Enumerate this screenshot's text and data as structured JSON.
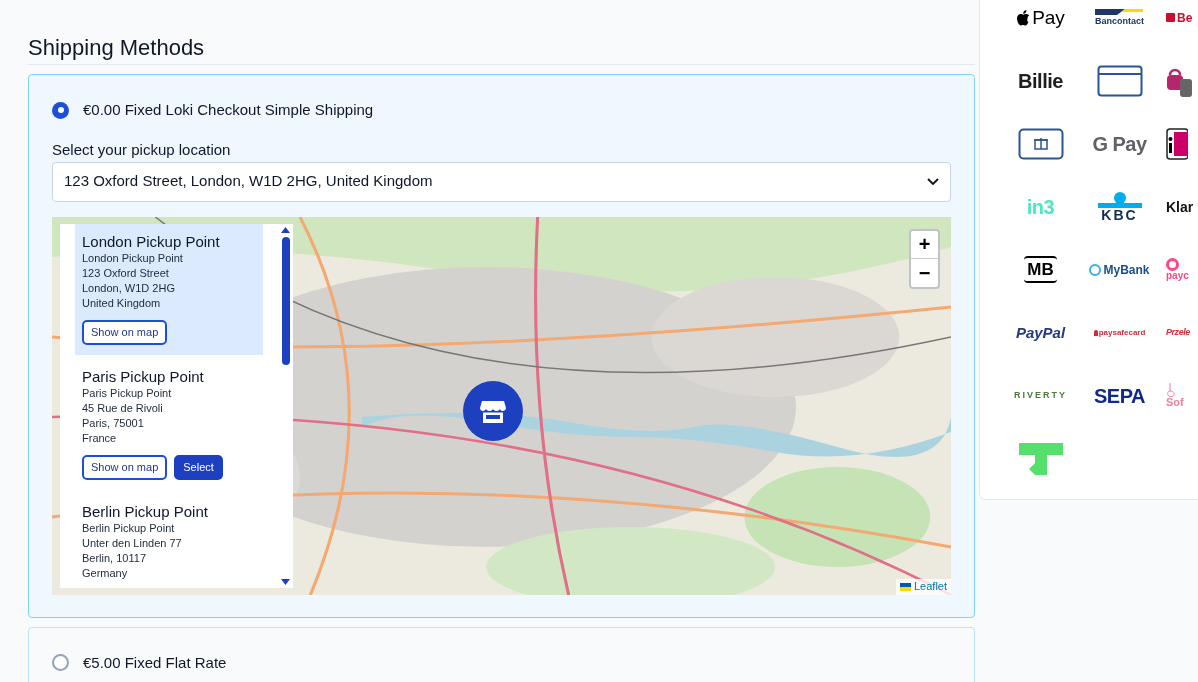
{
  "heading": "Shipping Methods",
  "methods": [
    {
      "label": "€0.00 Fixed Loki Checkout Simple Shipping",
      "selected": true,
      "pickup": {
        "label": "Select your pickup location",
        "value": "123 Oxford Street, London, W1D 2HG, United Kingdom",
        "points": [
          {
            "title": "London Pickup Point",
            "lines": [
              "London Pickup Point",
              "123 Oxford Street",
              "London, W1D 2HG",
              "United Kingdom"
            ],
            "selected": true,
            "buttons": [
              {
                "label": "Show on map",
                "kind": "outline"
              }
            ]
          },
          {
            "title": "Paris Pickup Point",
            "lines": [
              "Paris Pickup Point",
              "45 Rue de Rivoli",
              "Paris, 75001",
              "France"
            ],
            "selected": false,
            "buttons": [
              {
                "label": "Show on map",
                "kind": "outline"
              },
              {
                "label": "Select",
                "kind": "solid"
              }
            ]
          },
          {
            "title": "Berlin Pickup Point",
            "lines": [
              "Berlin Pickup Point",
              "Unter den Linden 77",
              "Berlin, 10117",
              "Germany"
            ],
            "selected": false
          }
        ],
        "zoom": [
          "+",
          "−"
        ],
        "attribution": "Leaflet"
      }
    },
    {
      "label": "€5.00 Fixed Flat Rate",
      "selected": false
    }
  ],
  "payment_logos": [
    {
      "kind": "apple",
      "label": "Pay",
      "color": "#000000"
    },
    {
      "kind": "bancontact",
      "label": "Bancontact",
      "color": "#1e3764"
    },
    {
      "kind": "square",
      "label": "Be",
      "color": "#c8102e"
    },
    {
      "kind": "text",
      "label": "Billie",
      "color": "#1f1f1f"
    },
    {
      "kind": "card"
    },
    {
      "kind": "epay"
    },
    {
      "kind": "gift"
    },
    {
      "kind": "text",
      "label": "G Pay",
      "color": "#5f6368"
    },
    {
      "kind": "ideal"
    },
    {
      "kind": "text",
      "label": "in3",
      "color": "#4ee8c0"
    },
    {
      "kind": "kbc",
      "label": "KBC",
      "color": "#0f2c57"
    },
    {
      "kind": "narrow",
      "label": "Klar",
      "color": "#17120f"
    },
    {
      "kind": "mb",
      "label": "MB",
      "color": "#000000"
    },
    {
      "kind": "mybank",
      "label": "MyBank",
      "color": "#1a4f8b"
    },
    {
      "kind": "payconiq",
      "label": "payc",
      "color": "#ff4785"
    },
    {
      "kind": "italic",
      "label": "PayPal",
      "color": "#253b80"
    },
    {
      "kind": "lock",
      "label": "paysafecard",
      "color": "#d62a3a"
    },
    {
      "kind": "small-italic",
      "label": "Przele",
      "color": "#d6303a"
    },
    {
      "kind": "spaced",
      "label": "RIVERTY",
      "color": "#4e7a3b"
    },
    {
      "kind": "text",
      "label": "SEPA",
      "color": "#10298e"
    },
    {
      "kind": "hand",
      "label": "Sof",
      "color": "#ef809f"
    },
    {
      "kind": "trustly"
    }
  ]
}
